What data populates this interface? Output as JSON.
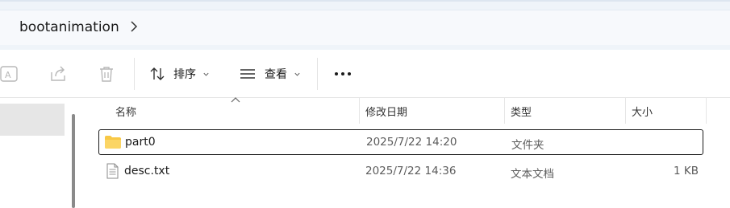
{
  "address_bar": {
    "breadcrumb": "bootanimation"
  },
  "toolbar": {
    "rename_icon": "rename-icon",
    "share_icon": "share-icon",
    "delete_icon": "trash-icon",
    "sort_label": "排序",
    "view_label": "查看",
    "more_icon": "more-icon"
  },
  "columns": {
    "name": "名称",
    "date": "修改日期",
    "type": "类型",
    "size": "大小"
  },
  "files": [
    {
      "name": "part0",
      "date": "2025/7/22 14:20",
      "type": "文件夹",
      "size": "",
      "icon": "folder-icon",
      "selected": true
    },
    {
      "name": "desc.txt",
      "date": "2025/7/22 14:36",
      "type": "文本文档",
      "size": "1 KB",
      "icon": "text-file-icon",
      "selected": false
    }
  ],
  "colors": {
    "folder": "#f8c846",
    "selection_border": "#1a1a1a",
    "toolbar_bg": "#eff4f9"
  }
}
